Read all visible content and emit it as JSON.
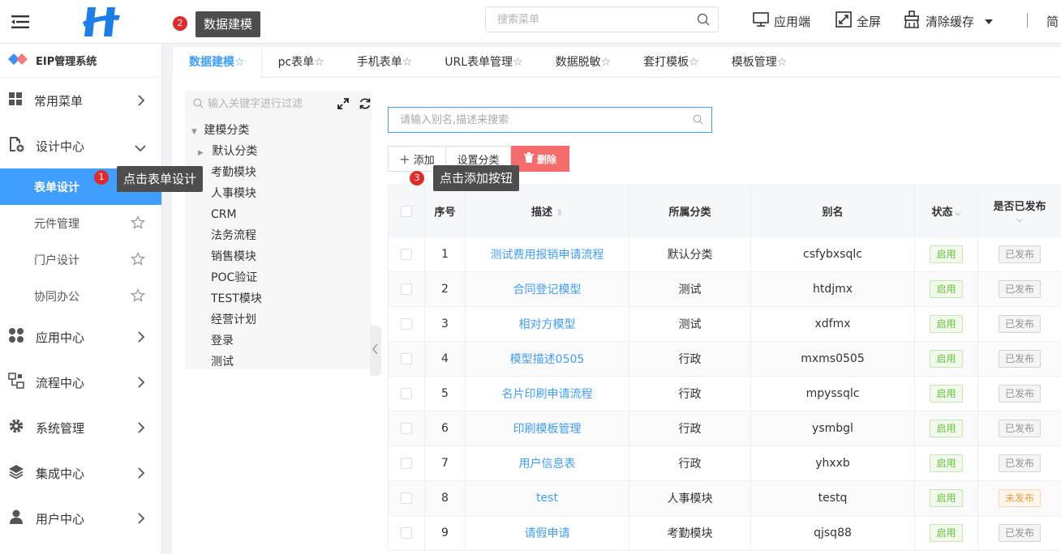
{
  "header": {
    "title": "数据建模",
    "title_badge": "2",
    "search_placeholder": "搜索菜单",
    "app_label": "应用端",
    "fullscreen_label": "全屏",
    "clear_cache_label": "清除缓存",
    "lang_label": "简"
  },
  "sidebar": {
    "system_title": "EIP管理系统",
    "items": [
      {
        "label": "常用菜单"
      },
      {
        "label": "设计中心"
      },
      {
        "label": "应用中心"
      },
      {
        "label": "流程中心"
      },
      {
        "label": "系统管理"
      },
      {
        "label": "集成中心"
      },
      {
        "label": "用户中心"
      }
    ],
    "sub_items": [
      {
        "label": "表单设计"
      },
      {
        "label": "元件管理"
      },
      {
        "label": "门户设计"
      },
      {
        "label": "协同办公"
      }
    ],
    "tooltip_badge": "1",
    "tooltip_text": "点击表单设计"
  },
  "tabs": [
    {
      "label": "数据建模"
    },
    {
      "label": "pc表单"
    },
    {
      "label": "手机表单"
    },
    {
      "label": "URL表单管理"
    },
    {
      "label": "数据脱敏"
    },
    {
      "label": "套打模板"
    },
    {
      "label": "模板管理"
    }
  ],
  "tree": {
    "search_placeholder": "输入关键字进行过滤",
    "root": "建模分类",
    "nodes": [
      "默认分类",
      "考勤模块",
      "人事模块",
      "CRM",
      "法务流程",
      "销售模块",
      "POC验证",
      "TEST模块",
      "经营计划",
      "登录",
      "测试"
    ]
  },
  "main": {
    "search_placeholder": "请输入别名,描述来搜索",
    "add_label": "添加",
    "set_category_label": "设置分类",
    "delete_label": "删除",
    "tooltip_badge": "3",
    "tooltip_text": "点击添加按钮"
  },
  "table": {
    "headers": {
      "index": "序号",
      "desc": "描述",
      "category": "所属分类",
      "alias": "别名",
      "status": "状态",
      "published": "是否已发布"
    },
    "rows": [
      {
        "index": "1",
        "desc": "测试费用报销申请流程",
        "category": "默认分类",
        "alias": "csfybxsqlc",
        "status": "启用",
        "published": "已发布"
      },
      {
        "index": "2",
        "desc": "合同登记模型",
        "category": "测试",
        "alias": "htdjmx",
        "status": "启用",
        "published": "已发布"
      },
      {
        "index": "3",
        "desc": "相对方模型",
        "category": "测试",
        "alias": "xdfmx",
        "status": "启用",
        "published": "已发布"
      },
      {
        "index": "4",
        "desc": "模型描述0505",
        "category": "行政",
        "alias": "mxms0505",
        "status": "启用",
        "published": "已发布"
      },
      {
        "index": "5",
        "desc": "名片印刷申请流程",
        "category": "行政",
        "alias": "mpyssqlc",
        "status": "启用",
        "published": "已发布"
      },
      {
        "index": "6",
        "desc": "印刷模板管理",
        "category": "行政",
        "alias": "ysmbgl",
        "status": "启用",
        "published": "已发布"
      },
      {
        "index": "7",
        "desc": "用户信息表",
        "category": "行政",
        "alias": "yhxxb",
        "status": "启用",
        "published": "已发布"
      },
      {
        "index": "8",
        "desc": "test",
        "category": "人事模块",
        "alias": "testq",
        "status": "启用",
        "published": "未发布"
      },
      {
        "index": "9",
        "desc": "请假申请",
        "category": "考勤模块",
        "alias": "qjsq88",
        "status": "启用",
        "published": "已发布"
      }
    ]
  },
  "colors": {
    "accent": "#409eff",
    "danger": "#f56c6c",
    "badge": "#e02b2b",
    "tooltip": "#4d4d4d"
  }
}
